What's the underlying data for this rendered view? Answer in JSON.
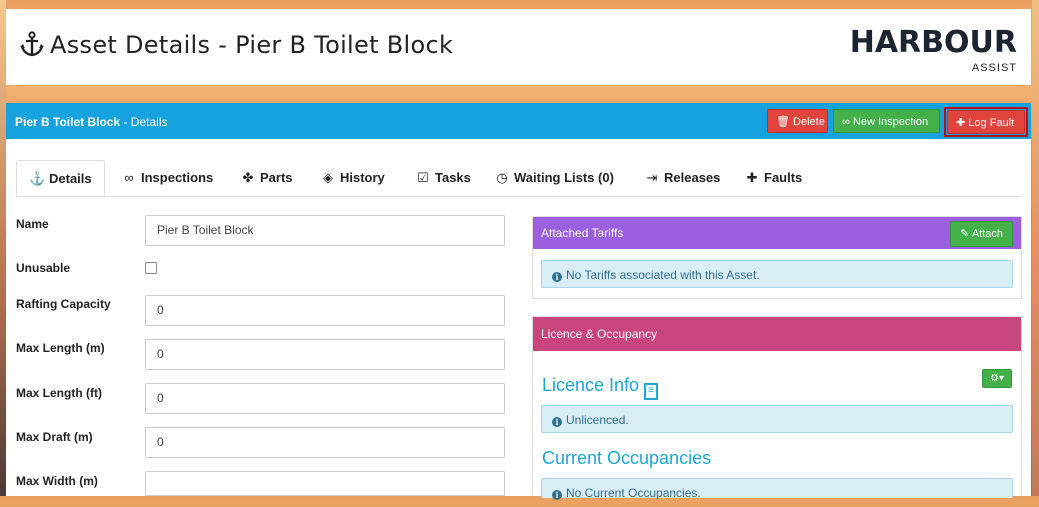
{
  "header": {
    "title": "Asset Details - Pier B Toilet Block",
    "logo_main": "HARBOUR",
    "logo_sub": "ASSIST"
  },
  "panel": {
    "title_bold": "Pier B Toilet Block",
    "title_rest": " - Details",
    "buttons": {
      "delete": "Delete",
      "new_inspection": "New Inspection",
      "log_fault": "Log Fault"
    }
  },
  "tabs": [
    {
      "label": "Details",
      "icon": "anchor-icon"
    },
    {
      "label": "Inspections",
      "icon": "glasses-icon"
    },
    {
      "label": "Parts",
      "icon": "puzzle-icon"
    },
    {
      "label": "History",
      "icon": "layers-icon"
    },
    {
      "label": "Tasks",
      "icon": "clipboard-check-icon"
    },
    {
      "label": "Waiting Lists (0)",
      "icon": "clock-icon"
    },
    {
      "label": "Releases",
      "icon": "sign-out-icon"
    },
    {
      "label": "Faults",
      "icon": "medkit-icon"
    }
  ],
  "form": {
    "name_label": "Name",
    "name_value": "Pier B Toilet Block",
    "unusable_label": "Unusable",
    "rafting_label": "Rafting Capacity",
    "rafting_value": "0",
    "maxlen_m_label": "Max Length (m)",
    "maxlen_m_value": "0",
    "maxlen_ft_label": "Max Length (ft)",
    "maxlen_ft_value": "0",
    "maxdraft_label": "Max Draft (m)",
    "maxdraft_value": "0",
    "maxwidth_label": "Max Width (m)",
    "maxwidth_value": ""
  },
  "tariffs": {
    "title": "Attached Tariffs",
    "attach": "Attach",
    "empty": "No Tariffs associated with this Asset."
  },
  "licence": {
    "title": "Licence & Occupancy",
    "info_title": "Licence Info",
    "unlicenced": "Unlicenced.",
    "occupancies_title": "Current Occupancies",
    "no_occupancies": "No Current Occupancies."
  },
  "colors": {
    "header_blue": "#15a2df",
    "danger": "#e0443c",
    "success": "#43b04a",
    "purple": "#9b5fe0",
    "pink": "#c9457e"
  }
}
